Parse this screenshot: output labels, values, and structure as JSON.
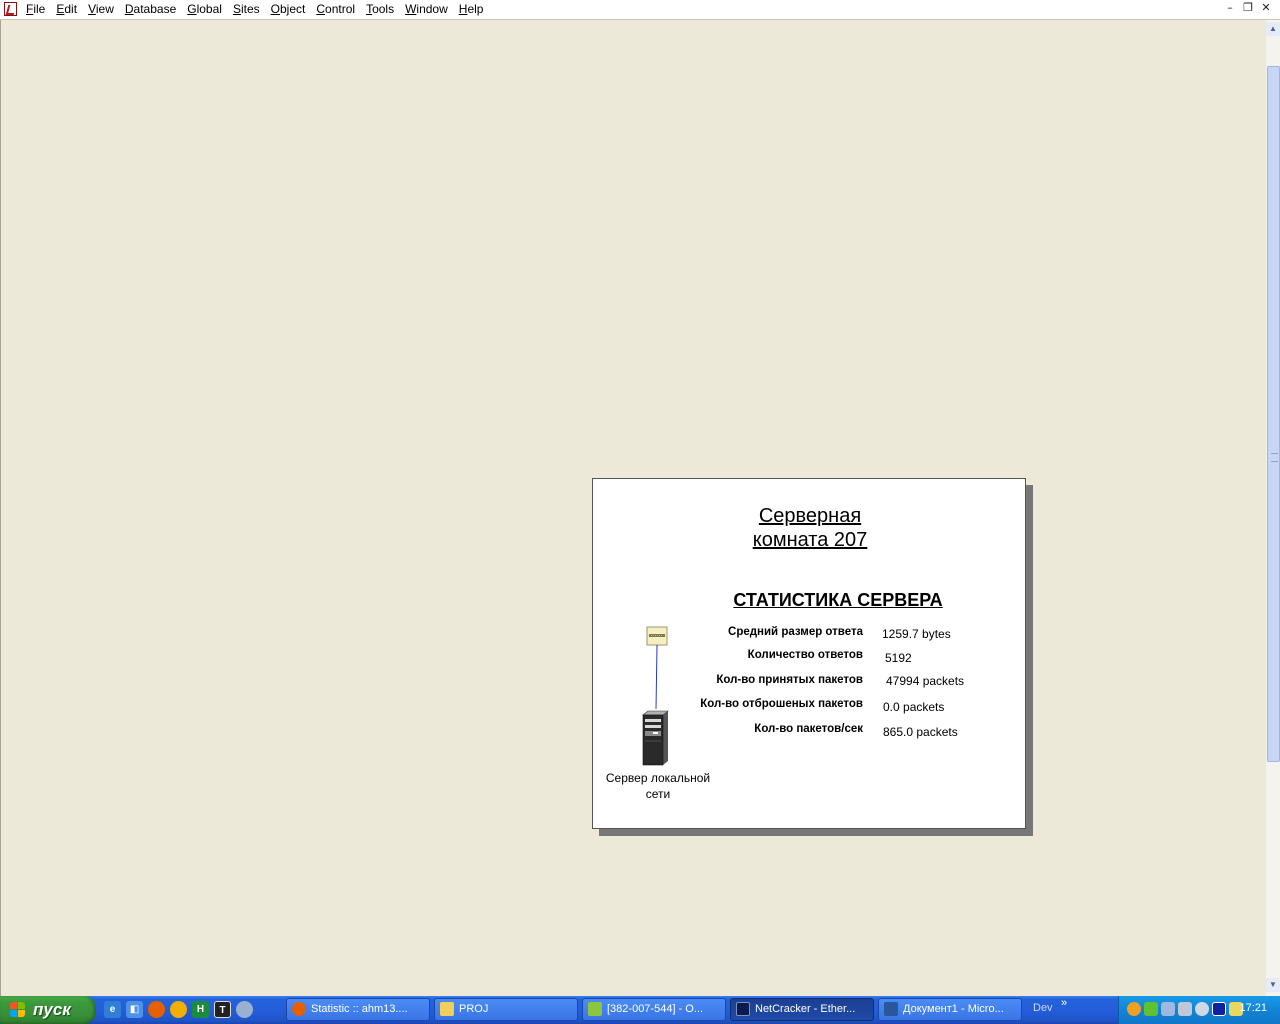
{
  "menubar": {
    "items": [
      {
        "mnemonic": "F",
        "rest": "ile"
      },
      {
        "mnemonic": "E",
        "rest": "dit"
      },
      {
        "mnemonic": "V",
        "rest": "iew"
      },
      {
        "mnemonic": "D",
        "rest": "atabase"
      },
      {
        "mnemonic": "G",
        "rest": "lobal"
      },
      {
        "mnemonic": "S",
        "rest": "ites"
      },
      {
        "mnemonic": "O",
        "rest": "bject"
      },
      {
        "mnemonic": "C",
        "rest": "ontrol"
      },
      {
        "mnemonic": "T",
        "rest": "ools"
      },
      {
        "mnemonic": "W",
        "rest": "indow"
      },
      {
        "mnemonic": "H",
        "rest": "elp"
      }
    ],
    "window_controls": {
      "minimize": "–",
      "restore": "❐",
      "close": "✕"
    }
  },
  "diagram": {
    "room_title_line1": "Серверная",
    "room_title_line2": "комната 207",
    "stats_title": "СТАТИСТИКА СЕРВЕРА",
    "stats": [
      {
        "label": "Средний размер ответа",
        "value": "1259.7 bytes"
      },
      {
        "label": "Количество ответов",
        "value": "5192"
      },
      {
        "label": "Кол-во принятых пакетов",
        "value": "47994 packets"
      },
      {
        "label": "Кол-во отброшеных пакетов",
        "value": "0.0 packets"
      },
      {
        "label": "Кол-во пакетов/сек",
        "value": "865.0 packets"
      }
    ],
    "server_label_line1": "Сервер локальной",
    "server_label_line2": "сети"
  },
  "taskbar": {
    "start_label": "пуск",
    "tasks": [
      {
        "label": "Statistic :: ahm13....",
        "icon": "firefox-icon",
        "color": "#e66000"
      },
      {
        "label": "PROJ",
        "icon": "folder-icon",
        "color": "#f2cf5b"
      },
      {
        "label": "[382-007-544] - O...",
        "icon": "chat-icon",
        "color": "#8cc63f"
      },
      {
        "label": "NetCracker - Ether...",
        "icon": "netcracker-icon",
        "color": "#1a2a6c"
      },
      {
        "label": "Документ1 - Micro...",
        "icon": "word-icon",
        "color": "#2b579a"
      }
    ],
    "dev_label": "Dev",
    "overflow_chevron": "»",
    "clock": "17:21"
  },
  "colors": {
    "workspace": "#ece9d8",
    "taskbar_blue": "#245edb",
    "start_green": "#388e38",
    "tray_blue": "#1184d6"
  }
}
